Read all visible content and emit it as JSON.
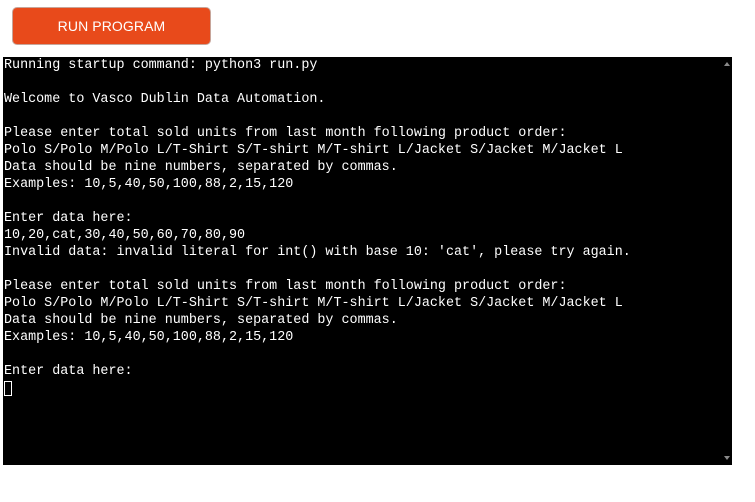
{
  "toolbar": {
    "run_label": "RUN PROGRAM"
  },
  "terminal": {
    "lines": [
      "Running startup command: python3 run.py",
      "",
      "Welcome to Vasco Dublin Data Automation.",
      "",
      "Please enter total sold units from last month following product order:",
      "Polo S/Polo M/Polo L/T-Shirt S/T-shirt M/T-shirt L/Jacket S/Jacket M/Jacket L",
      "Data should be nine numbers, separated by commas.",
      "Examples: 10,5,40,50,100,88,2,15,120",
      "",
      "Enter data here:",
      "10,20,cat,30,40,50,60,70,80,90",
      "Invalid data: invalid literal for int() with base 10: 'cat', please try again.",
      "",
      "Please enter total sold units from last month following product order:",
      "Polo S/Polo M/Polo L/T-Shirt S/T-shirt M/T-shirt L/Jacket S/Jacket M/Jacket L",
      "Data should be nine numbers, separated by commas.",
      "Examples: 10,5,40,50,100,88,2,15,120",
      "",
      "Enter data here:"
    ]
  },
  "colors": {
    "button_bg": "#e84a1b",
    "terminal_bg": "#000000",
    "terminal_fg": "#ffffff"
  }
}
